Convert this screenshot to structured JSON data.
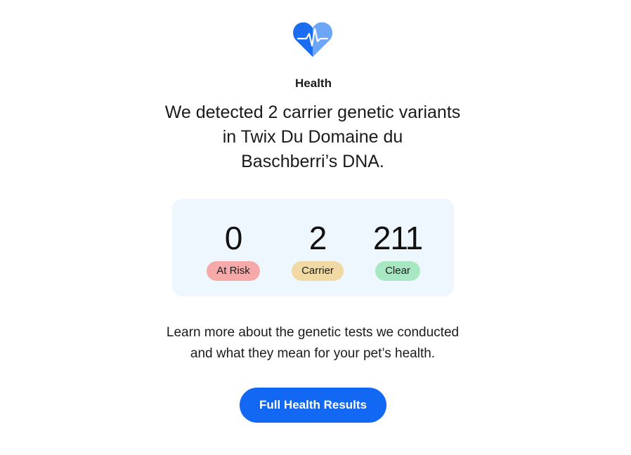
{
  "icon": "heart-pulse-icon",
  "colors": {
    "heart_primary": "#1a6cf0",
    "heart_secondary": "#6ea6f7",
    "card_background": "#edf7fd",
    "at_risk": "#f5a9a9",
    "carrier": "#f0d9a2",
    "clear": "#a7e8c3",
    "button": "#1268f2"
  },
  "section_label": "Health",
  "headline": {
    "line1": "We detected 2 carrier genetic variants",
    "line2": "in Twix Du Domaine du",
    "line3": "Baschberri’s DNA."
  },
  "stats": [
    {
      "value": "0",
      "label": "At Risk"
    },
    {
      "value": "2",
      "label": "Carrier"
    },
    {
      "value": "211",
      "label": "Clear"
    }
  ],
  "learn_more": {
    "line1": "Learn more about the genetic tests we conducted",
    "line2": "and what they mean for your pet’s health."
  },
  "button_label": "Full Health Results"
}
